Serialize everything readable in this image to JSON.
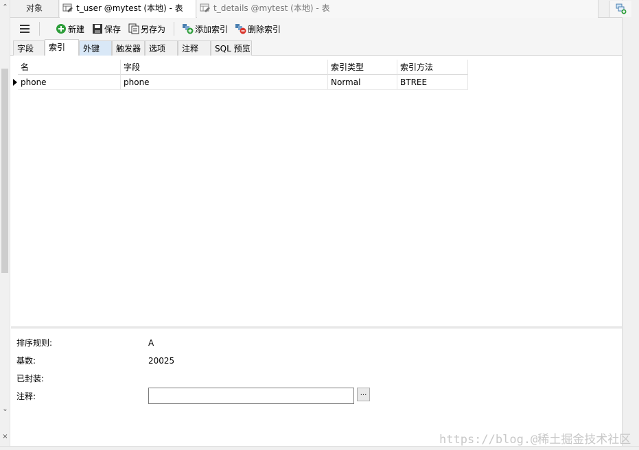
{
  "tabs": {
    "objects_label": "对象",
    "active_title": "t_user @mytest (本地) - 表",
    "inactive_title": "t_details @mytest (本地) - 表"
  },
  "toolbar": {
    "new_label": "新建",
    "save_label": "保存",
    "save_as_label": "另存为",
    "add_index_label": "添加索引",
    "delete_index_label": "删除索引"
  },
  "subtabs": [
    "字段",
    "索引",
    "外键",
    "触发器",
    "选项",
    "注释",
    "SQL 预览"
  ],
  "grid": {
    "columns": [
      "名",
      "字段",
      "索引类型",
      "索引方法"
    ],
    "rows": [
      [
        "phone",
        "phone",
        "Normal",
        "BTREE"
      ]
    ]
  },
  "properties": {
    "collation_label": "排序规则:",
    "collation_value": "A",
    "cardinality_label": "基数:",
    "cardinality_value": "20025",
    "packed_label": "已封装:",
    "comment_label": "注释:",
    "comment_value": "",
    "browse_label": "..."
  },
  "watermark": "https://blog.@稀土掘金技术社区",
  "colors": {
    "active_subtab_hover": "#d9e8f7",
    "add_icon": "#2e9e3b",
    "delete_icon": "#d9342b"
  }
}
